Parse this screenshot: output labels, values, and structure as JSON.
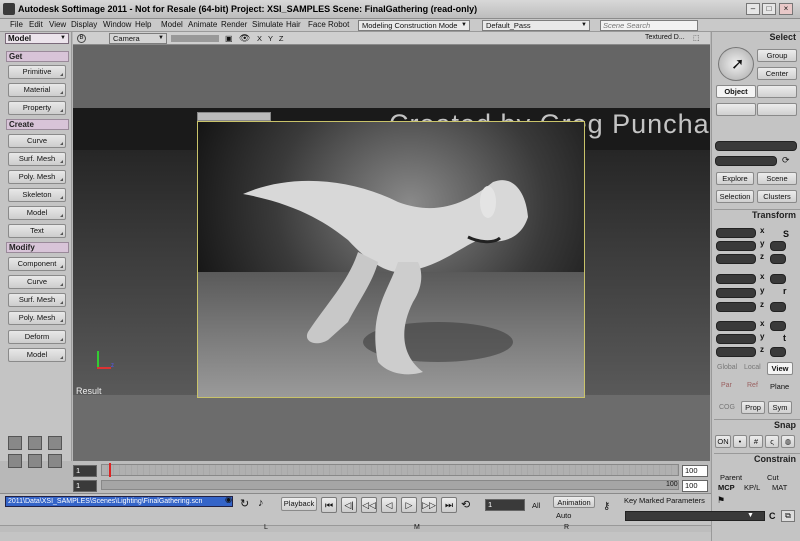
{
  "window": {
    "title": "Autodesk Softimage 2011  -  Not for Resale (64-bit)     Project: XSI_SAMPLES     Scene: FinalGathering (read-only)"
  },
  "menu": [
    "File",
    "Edit",
    "View",
    "Display",
    "Window",
    "Help",
    "Model",
    "Animate",
    "Render",
    "Simulate",
    "Hair",
    "Face Robot"
  ],
  "toolbar": {
    "construction_mode": "Modeling Construction Mode",
    "render_pass": "Default_Pass",
    "scene_search_placeholder": "Scene Search"
  },
  "left_panel": {
    "mode": "Model",
    "sections": [
      {
        "label": "Get",
        "buttons": [
          "Primitive",
          "Material",
          "Property"
        ]
      },
      {
        "label": "Create",
        "buttons": [
          "Curve",
          "Surf. Mesh",
          "Poly. Mesh",
          "Skeleton",
          "Model",
          "Text"
        ]
      },
      {
        "label": "Modify",
        "buttons": [
          "Component",
          "Curve",
          "Surf. Mesh",
          "Poly. Mesh",
          "Deform",
          "Model"
        ]
      }
    ]
  },
  "viewport": {
    "camera": "Camera",
    "axes": "X Y Z",
    "shading": "Textured D...",
    "result_label": "Result",
    "watermark": "Created by Greg Punchatz"
  },
  "right_panel": {
    "select_title": "Select",
    "group": "Group",
    "center": "Center",
    "object": "Object",
    "explore": "Explore",
    "scene": "Scene",
    "selection": "Selection",
    "clusters": "Clusters",
    "transform_title": "Transform",
    "axes": [
      "x",
      "y",
      "z"
    ],
    "s_label": "S",
    "r_label": "r",
    "t_label": "t",
    "global": "Global",
    "local": "Local",
    "view": "View",
    "par": "Par",
    "ref": "Ref",
    "plane": "Plane",
    "cog": "COG",
    "prop": "Prop",
    "sym": "Sym",
    "snap_title": "Snap",
    "on": "ON",
    "constrain_title": "Constrain",
    "parent": "Parent",
    "cut": "Cut",
    "mcp": "MCP",
    "kpl": "KP/L",
    "mat": "MAT"
  },
  "timeline": {
    "start": "1",
    "end": "100",
    "current_a": "1",
    "end_b": "100",
    "range_start": "1",
    "range_end": "100"
  },
  "bottom": {
    "path": "2011\\Data\\XSI_SAMPLES\\Scenes\\Lighting\\FinalGathering.scn",
    "playback": "Playback",
    "frame": "1",
    "all": "All",
    "animation": "Animation",
    "auto": "Auto",
    "key_marked": "Key Marked Parameters",
    "l": "L",
    "m": "M",
    "r": "R",
    "c": "C"
  }
}
